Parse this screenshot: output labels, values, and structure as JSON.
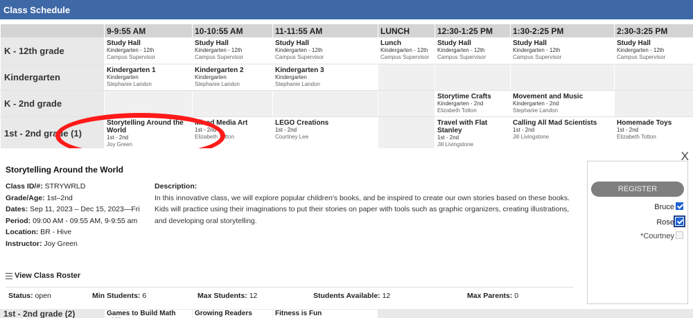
{
  "header": {
    "title": "Class Schedule"
  },
  "schedule": {
    "time_slots": [
      "9-9:55 AM",
      "10-10:55 AM",
      "11-11:55 AM",
      "LUNCH",
      "12:30-1:25 PM",
      "1:30-2:25 PM",
      "2:30-3:25 PM"
    ],
    "rows": [
      {
        "grade": "K - 12th grade",
        "cells": [
          {
            "title": "Study Hall",
            "grade": "Kindergarten - 12th",
            "teacher": "Campus Supervisor"
          },
          {
            "title": "Study Hall",
            "grade": "Kindergarten - 12th",
            "teacher": "Campus Supervisor"
          },
          {
            "title": "Study Hall",
            "grade": "Kindergarten - 12th",
            "teacher": "Campus Supervisor"
          },
          {
            "title": "Lunch",
            "grade": "Kindergarten - 12th",
            "teacher": "Campus Supervisor"
          },
          {
            "title": "Study Hall",
            "grade": "Kindergarten - 12th",
            "teacher": "Campus Supervisor"
          },
          {
            "title": "Study Hall",
            "grade": "Kindergarten - 12th",
            "teacher": "Campus Supervisor"
          },
          {
            "title": "Study Hall",
            "grade": "Kindergarten - 12th",
            "teacher": "Campus Supervisor"
          }
        ]
      },
      {
        "grade": "Kindergarten",
        "cells": [
          {
            "title": "Kindergarten 1",
            "grade": "Kindergarten",
            "teacher": "Stephanie Landon"
          },
          {
            "title": "Kindergarten 2",
            "grade": "Kindergarten",
            "teacher": "Stephanie Landon"
          },
          {
            "title": "Kindergarten 3",
            "grade": "Kindergarten",
            "teacher": "Stephanie Landon"
          },
          null,
          null,
          null,
          null
        ]
      },
      {
        "grade": "K - 2nd grade",
        "cells": [
          null,
          null,
          null,
          null,
          {
            "title": "Storytime Crafts",
            "grade": "Kindergarten - 2nd",
            "teacher": "Elizabeth Totton"
          },
          {
            "title": "Movement and Music",
            "grade": "Kindergarten - 2nd",
            "teacher": "Stephanie Landon"
          },
          null
        ]
      },
      {
        "grade": "1st - 2nd grade (1)",
        "cells": [
          {
            "title": "Storytelling Around the World",
            "grade": "1st - 2nd",
            "teacher": "Joy Green"
          },
          {
            "title": "Mixed Media Art",
            "grade": "1st - 2nd",
            "teacher": "Elizabeth Totton"
          },
          {
            "title": "LEGO Creations",
            "grade": "1st - 2nd",
            "teacher": "Courtney Lee"
          },
          null,
          {
            "title": "Travel with Flat Stanley",
            "grade": "1st - 2nd",
            "teacher": "Jill Livingstone"
          },
          {
            "title": "Calling All Mad Scientists",
            "grade": "1st - 2nd",
            "teacher": "Jill Livingstone"
          },
          {
            "title": "Homemade Toys",
            "grade": "1st - 2nd",
            "teacher": "Elizabeth Totton"
          }
        ]
      }
    ]
  },
  "detail": {
    "close": "X",
    "title": "Storytelling Around the World",
    "class_id_label": "Class ID/#:",
    "class_id": "STRYWRLD",
    "grade_label": "Grade/Age:",
    "grade": "1st–2nd",
    "dates_label": "Dates:",
    "dates": "Sep 11, 2023 – Dec 15, 2023—Fri",
    "period_label": "Period:",
    "period": "09:00 AM - 09:55 AM, 9-9:55 am",
    "location_label": "Location:",
    "location": "BR - Hive",
    "instructor_label": "Instructor:",
    "instructor": "Joy Green",
    "description_label": "Description:",
    "description": "In this innovative class, we will explore popular children's books, and be inspired to create our own stories based on these books. Kids will practice using their imaginations to put their stories on paper with tools such as graphic organizers, creating illustrations, and developing oral storytelling.",
    "roster_link": "View Class Roster",
    "status_label": "Status:",
    "status": "open",
    "min_label": "Min Students:",
    "min": "6",
    "max_label": "Max Students:",
    "max": "12",
    "avail_label": "Students Available:",
    "avail": "12",
    "parents_label": "Max Parents:",
    "parents": "0"
  },
  "register": {
    "button": "REGISTER",
    "kids": [
      {
        "name": "Bruce",
        "checked": true
      },
      {
        "name": "Rose",
        "checked": true
      },
      {
        "name": "*Courtney",
        "checked": false
      }
    ]
  },
  "next_row": {
    "grade": "1st - 2nd grade (2)",
    "cells": [
      "Games to Build Math Skills",
      "Growing Readers",
      "Fitness is Fun"
    ]
  }
}
